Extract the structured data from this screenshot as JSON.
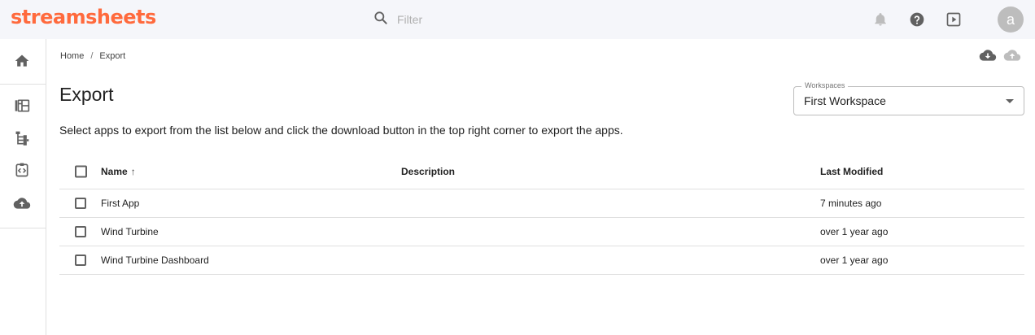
{
  "app": {
    "logo_text": "streamsheets"
  },
  "search": {
    "placeholder": "Filter"
  },
  "topbar_icons": [
    "bell-icon",
    "help-icon",
    "play-box-icon"
  ],
  "user": {
    "avatar_initial": "a"
  },
  "sidebar": {
    "items": [
      {
        "name": "home",
        "icon": "home-icon"
      },
      {
        "name": "dashboard",
        "icon": "dashboard-icon"
      },
      {
        "name": "machines",
        "icon": "machine-tree-icon"
      },
      {
        "name": "code",
        "icon": "code-box-icon"
      },
      {
        "name": "upload",
        "icon": "cloud-upload-icon"
      }
    ]
  },
  "breadcrumb": {
    "home": "Home",
    "separator": "/",
    "current": "Export"
  },
  "actions": {
    "download_icon": "cloud-download-icon",
    "upload_icon": "cloud-upload-icon"
  },
  "page": {
    "title": "Export",
    "instructions": "Select apps to export from the list below and click the download button in the top right corner to export the apps."
  },
  "workspace_select": {
    "label": "Workspaces",
    "value": "First Workspace"
  },
  "table": {
    "headers": {
      "name": "Name",
      "sort_indicator": "↑",
      "description": "Description",
      "last_modified": "Last Modified"
    },
    "rows": [
      {
        "name": "First App",
        "description": "",
        "last_modified": "7 minutes ago"
      },
      {
        "name": "Wind Turbine",
        "description": "",
        "last_modified": "over 1 year ago"
      },
      {
        "name": "Wind Turbine Dashboard",
        "description": "",
        "last_modified": "over 1 year ago"
      }
    ]
  },
  "colors": {
    "brand": "#ff6a3d",
    "topbar_bg": "#f5f6fa",
    "icon_grey": "#616161",
    "icon_light": "#bdbdbd"
  }
}
